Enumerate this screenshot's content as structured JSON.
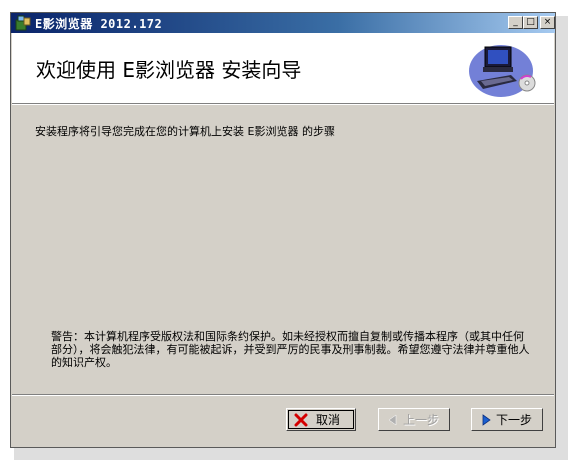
{
  "window": {
    "title": "E影浏览器 2012.172",
    "minimize_glyph": "_",
    "maximize_glyph": "□",
    "close_glyph": "×"
  },
  "header": {
    "title": "欢迎使用 E影浏览器 安装向导",
    "banner_icon": "computer-cd-icon"
  },
  "body": {
    "intro": "安装程序将引导您完成在您的计算机上安装 E影浏览器 的步骤",
    "warning": "警告：本计算机程序受版权法和国际条约保护。如未经授权而擅自复制或传播本程序（或其中任何部分），将会触犯法律，有可能被起诉，并受到严厉的民事及刑事制裁。希望您遵守法律并尊重他人的知识产权。"
  },
  "buttons": {
    "cancel": "取消",
    "back": "上一步",
    "next": "下一步"
  },
  "colors": {
    "titlebar_start": "#0a246a",
    "titlebar_end": "#a6caf0",
    "dialog_face": "#d4d0c8",
    "cancel_icon": "#d40000",
    "next_icon": "#1a5fd0"
  }
}
